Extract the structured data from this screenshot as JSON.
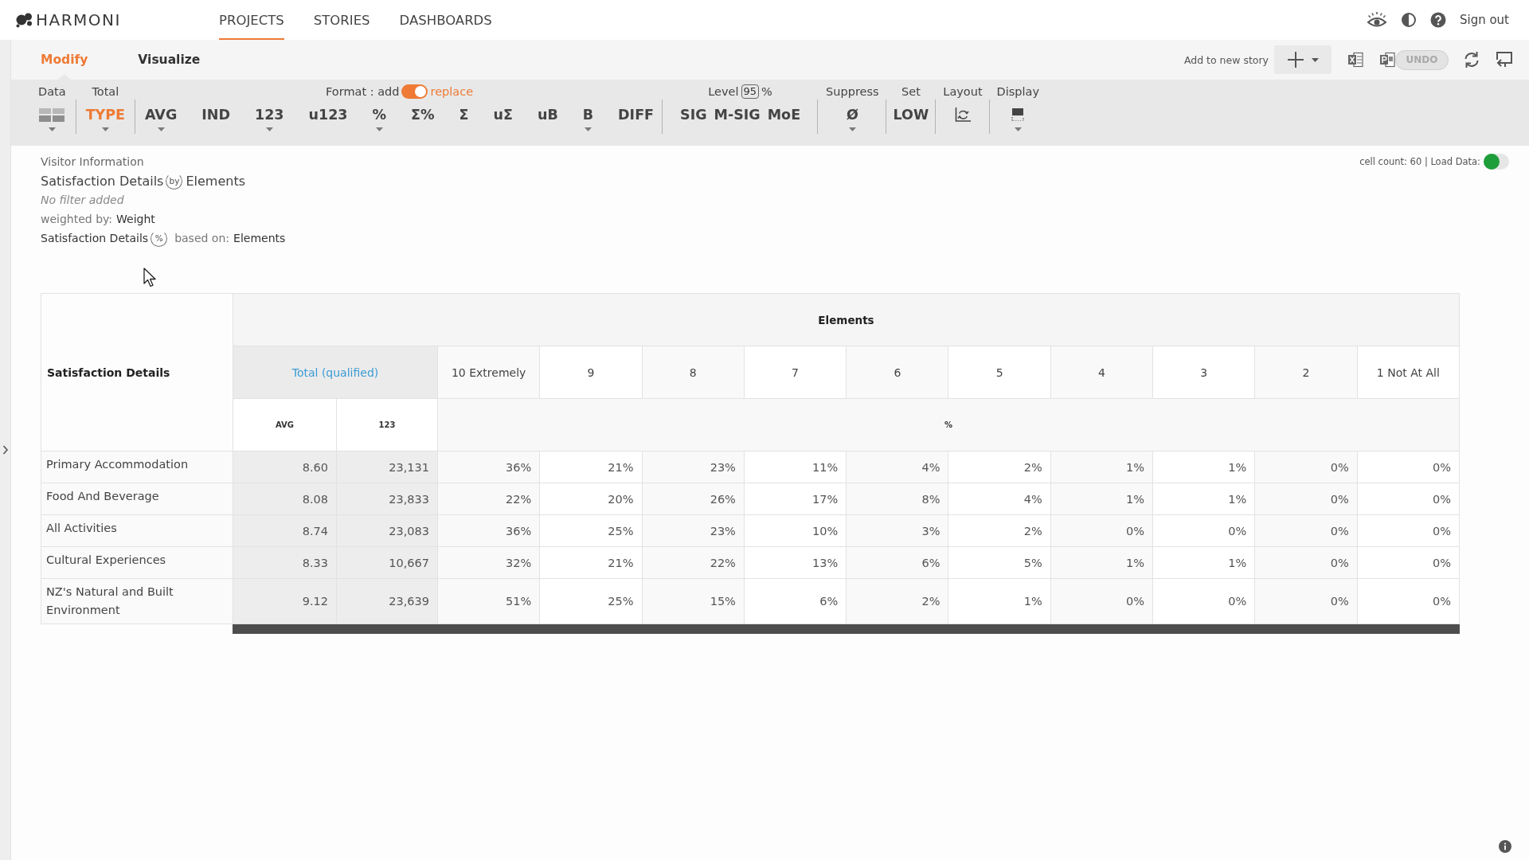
{
  "header": {
    "logo": "HARMONI",
    "nav": [
      {
        "label": "PROJECTS",
        "selected": true
      },
      {
        "label": "STORIES",
        "selected": false
      },
      {
        "label": "DASHBOARDS",
        "selected": false
      }
    ],
    "sign_out": "Sign out"
  },
  "subbar": {
    "tabs": [
      {
        "label": "Modify",
        "selected": true
      },
      {
        "label": "Visualize",
        "selected": false
      }
    ],
    "add_to_story": "Add to new story",
    "undo": {
      "label": "UNDO",
      "disabled": true
    }
  },
  "toolbar": {
    "groups": [
      {
        "kind": "plain",
        "label": "Data",
        "items": [
          {
            "kind": "grid",
            "caret": true,
            "selected": false
          }
        ]
      },
      {
        "kind": "plain",
        "label": "Total",
        "items": [
          {
            "kind": "text",
            "label": "TYPE",
            "caret": true,
            "selected": true
          }
        ]
      },
      {
        "kind": "format",
        "label": "Format : add",
        "option": "replace",
        "on": true,
        "items": [
          {
            "kind": "text",
            "label": "AVG",
            "caret": true,
            "selected": false
          },
          {
            "kind": "text",
            "label": "IND",
            "caret": false,
            "selected": false
          },
          {
            "kind": "text",
            "label": "123",
            "caret": true,
            "selected": false
          },
          {
            "kind": "text",
            "label": "u123",
            "caret": false,
            "selected": false
          },
          {
            "kind": "text",
            "label": "%",
            "caret": true,
            "selected": false
          },
          {
            "kind": "text",
            "label": "Σ%",
            "caret": false,
            "selected": false
          },
          {
            "kind": "text",
            "label": "Σ",
            "caret": false,
            "selected": false
          },
          {
            "kind": "text",
            "label": "uΣ",
            "caret": false,
            "selected": false
          },
          {
            "kind": "text",
            "label": "uB",
            "caret": false,
            "selected": false
          },
          {
            "kind": "text",
            "label": "B",
            "caret": true,
            "selected": false
          },
          {
            "kind": "text",
            "label": "DIFF",
            "caret": false,
            "selected": false
          }
        ]
      },
      {
        "kind": "level",
        "label": "Level",
        "value": "95",
        "unit": "%",
        "items": [
          {
            "kind": "text",
            "label": "SIG",
            "caret": false,
            "selected": false
          },
          {
            "kind": "text",
            "label": "M-SIG",
            "caret": false,
            "selected": false
          },
          {
            "kind": "text",
            "label": "MoE",
            "caret": false,
            "selected": false
          }
        ]
      },
      {
        "kind": "plain",
        "label": "Suppress",
        "items": [
          {
            "kind": "text",
            "label": "Ø",
            "caret": true,
            "selected": false
          }
        ]
      },
      {
        "kind": "plain",
        "label": "Set",
        "items": [
          {
            "kind": "text",
            "label": "LOW",
            "caret": false,
            "selected": false
          }
        ]
      },
      {
        "kind": "plain",
        "label": "Layout",
        "items": [
          {
            "kind": "layout",
            "caret": false,
            "selected": false
          }
        ]
      },
      {
        "kind": "plain",
        "label": "Display",
        "items": [
          {
            "kind": "display",
            "caret": true,
            "selected": false
          }
        ]
      }
    ]
  },
  "report": {
    "breadcrumb": "Visitor Information",
    "title_row": "Satisfaction Details",
    "title_connector": "by",
    "title_column": "Elements",
    "filter": "No filter added",
    "weight_label": "weighted by:",
    "weight": "Weight",
    "base_row": "Satisfaction Details",
    "base_connector": "%",
    "base_label": "based on:",
    "base_value": "Elements",
    "cell_count": "cell count: 60 | Load Data:",
    "load_data": {
      "on": false
    }
  },
  "table": {
    "row_header": "Satisfaction Details",
    "column_header": "Elements",
    "total_label": "Total (qualified)",
    "total_measures": [
      "AVG",
      "123"
    ],
    "categories": [
      "10 Extremely",
      "9",
      "8",
      "7",
      "6",
      "5",
      "4",
      "3",
      "2",
      "1 Not At All"
    ],
    "category_measure": "%",
    "rows": [
      {
        "label": "Primary Accommodation",
        "total": [
          "8.60",
          "23,131"
        ],
        "values": [
          "36%",
          "21%",
          "23%",
          "11%",
          "4%",
          "2%",
          "1%",
          "1%",
          "0%",
          "0%"
        ]
      },
      {
        "label": "Food And Beverage",
        "total": [
          "8.08",
          "23,833"
        ],
        "values": [
          "22%",
          "20%",
          "26%",
          "17%",
          "8%",
          "4%",
          "1%",
          "1%",
          "0%",
          "0%"
        ]
      },
      {
        "label": "All Activities",
        "total": [
          "8.74",
          "23,083"
        ],
        "values": [
          "36%",
          "25%",
          "23%",
          "10%",
          "3%",
          "2%",
          "0%",
          "0%",
          "0%",
          "0%"
        ]
      },
      {
        "label": "Cultural Experiences",
        "total": [
          "8.33",
          "10,667"
        ],
        "values": [
          "32%",
          "21%",
          "22%",
          "13%",
          "6%",
          "5%",
          "1%",
          "1%",
          "0%",
          "0%"
        ]
      },
      {
        "label": "NZ's Natural and Built Environment",
        "total": [
          "9.12",
          "23,639"
        ],
        "values": [
          "51%",
          "25%",
          "15%",
          "6%",
          "2%",
          "1%",
          "0%",
          "0%",
          "0%",
          "0%"
        ]
      }
    ]
  }
}
